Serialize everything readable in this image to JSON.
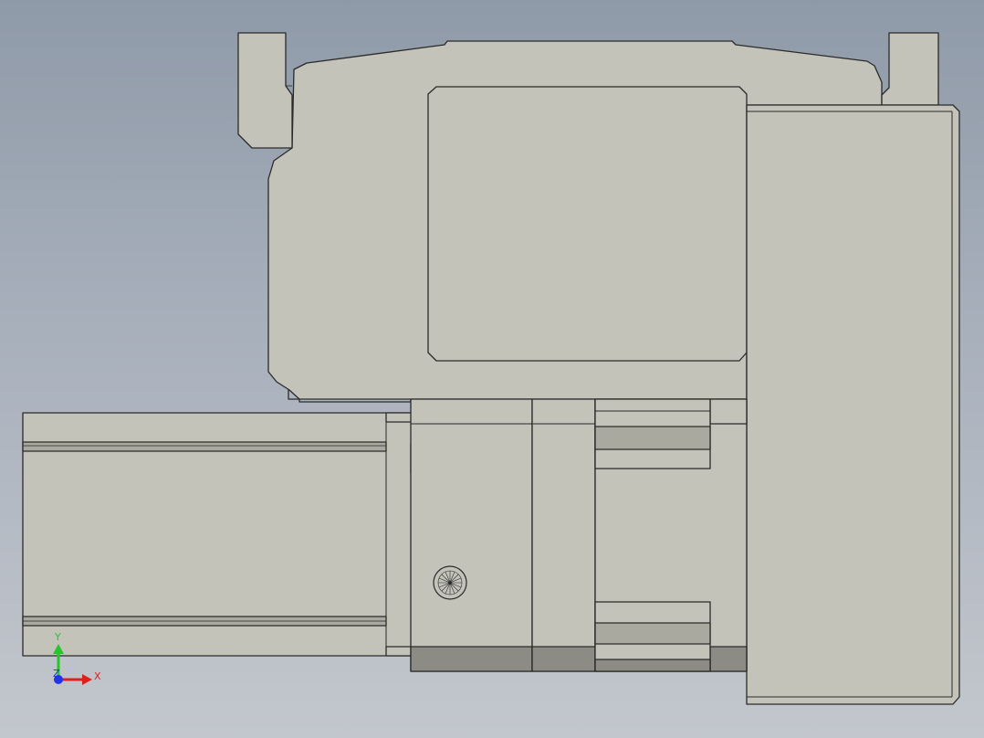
{
  "viewport": {
    "background_top": "#8f9aa8",
    "background_bottom": "#c3c7cd",
    "part_fill": "#c3c3ba",
    "part_shade": "#a9a9a0",
    "part_dark": "#8c8c85",
    "edge_color": "#2a2a2a"
  },
  "triad": {
    "x_label": "X",
    "y_label": "Y",
    "z_label": "Z",
    "x_color": "#e0201c",
    "y_color": "#25c629",
    "z_color": "#2232e8"
  }
}
